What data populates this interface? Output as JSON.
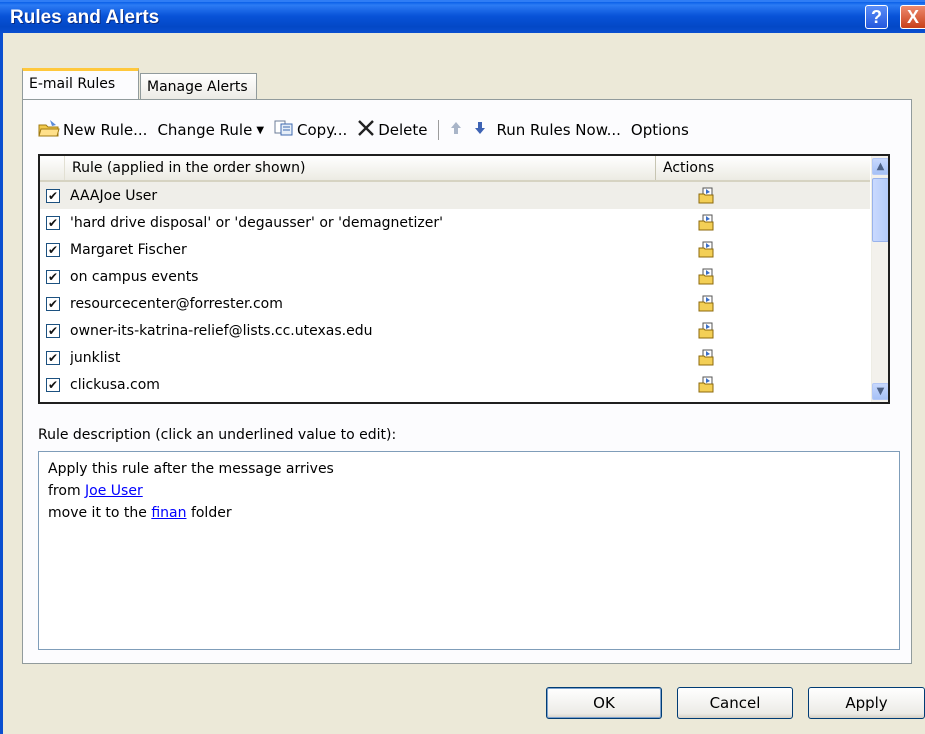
{
  "window": {
    "title": "Rules and Alerts",
    "help_label": "?",
    "close_label": "X"
  },
  "tabs": [
    {
      "label": "E-mail Rules",
      "active": true
    },
    {
      "label": "Manage Alerts",
      "active": false
    }
  ],
  "toolbar": {
    "new_rule": "New Rule...",
    "change_rule": "Change Rule",
    "copy": "Copy...",
    "delete": "Delete",
    "run_rules_now": "Run Rules Now...",
    "options": "Options"
  },
  "rules_table": {
    "columns": [
      "Rule (applied in the order shown)",
      "Actions"
    ],
    "rows": [
      {
        "name": "AAAJoe User",
        "checked": true,
        "selected": true
      },
      {
        "name": "'hard drive disposal' or 'degausser' or 'demagnetizer'",
        "checked": true,
        "selected": false
      },
      {
        "name": "Margaret Fischer",
        "checked": true,
        "selected": false
      },
      {
        "name": "on campus events",
        "checked": true,
        "selected": false
      },
      {
        "name": "resourcecenter@forrester.com",
        "checked": true,
        "selected": false
      },
      {
        "name": "owner-its-katrina-relief@lists.cc.utexas.edu",
        "checked": true,
        "selected": false
      },
      {
        "name": "junklist",
        "checked": true,
        "selected": false
      },
      {
        "name": "clickusa.com",
        "checked": true,
        "selected": false
      }
    ],
    "action_icon": "move-to-folder-icon"
  },
  "description": {
    "label": "Rule description (click an underlined value to edit):",
    "line1": "Apply this rule after the message arrives",
    "line2_prefix": "from",
    "line2_link": "Joe User",
    "line3_prefix": "move it to the",
    "line3_link": "finan",
    "line3_suffix": "folder"
  },
  "buttons": {
    "ok": "OK",
    "cancel": "Cancel",
    "apply": "Apply"
  },
  "colors": {
    "titlebar": "#0A4FD0",
    "dialog_bg": "#ECE9D8",
    "link": "#0000FF",
    "active_tab_accent": "#FFC83C"
  }
}
